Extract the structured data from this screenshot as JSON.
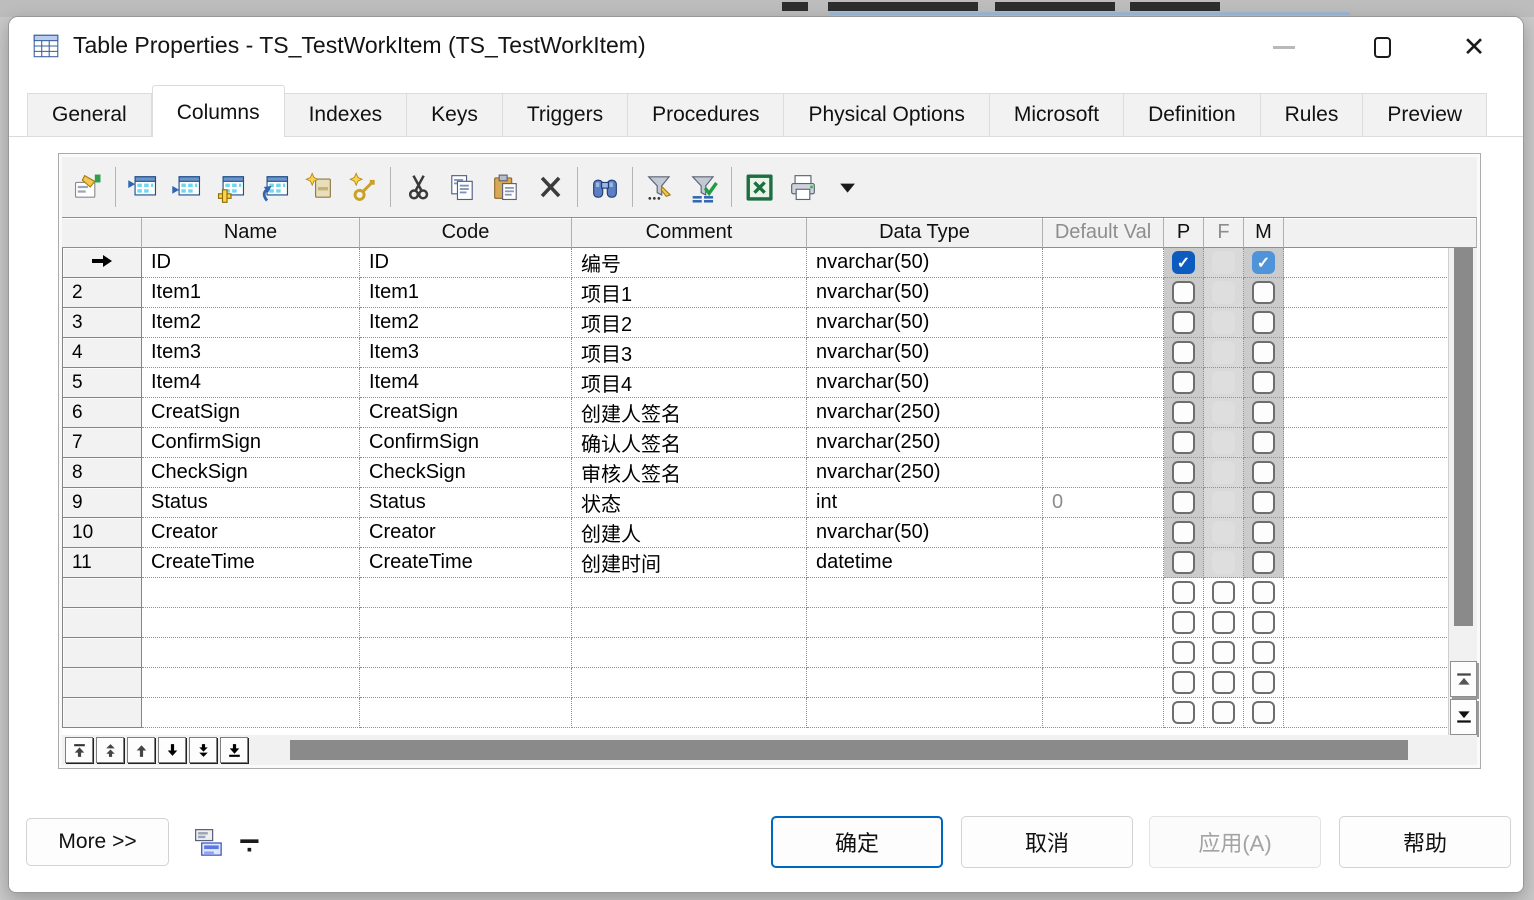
{
  "window": {
    "title": "Table Properties - TS_TestWorkItem (TS_TestWorkItem)"
  },
  "tabs": [
    {
      "label": "General",
      "active": false
    },
    {
      "label": "Columns",
      "active": true
    },
    {
      "label": "Indexes",
      "active": false
    },
    {
      "label": "Keys",
      "active": false
    },
    {
      "label": "Triggers",
      "active": false
    },
    {
      "label": "Procedures",
      "active": false
    },
    {
      "label": "Physical Options",
      "active": false
    },
    {
      "label": "Microsoft",
      "active": false
    },
    {
      "label": "Definition",
      "active": false
    },
    {
      "label": "Rules",
      "active": false
    },
    {
      "label": "Preview",
      "active": false
    }
  ],
  "toolbar": {
    "groups": [
      [
        "properties"
      ],
      [
        "insert-row-top",
        "insert-row",
        "add-row",
        "reorder-rows",
        "remove-summary",
        "generate-key"
      ],
      [
        "cut",
        "copy",
        "paste",
        "delete"
      ],
      [
        "find"
      ],
      [
        "filter-define",
        "filter-toggle"
      ],
      [
        "export-excel",
        "print",
        "print-dropdown"
      ]
    ]
  },
  "grid": {
    "headers": {
      "rowhdr": "",
      "name": "Name",
      "code": "Code",
      "comment": "Comment",
      "data_type": "Data Type",
      "default_value": "Default Val",
      "p": "P",
      "f": "F",
      "m": "M"
    },
    "rows": [
      {
        "num": "",
        "current": true,
        "name": "ID",
        "code": "ID",
        "comment": "编号",
        "data_type": "nvarchar(50)",
        "default_value": "",
        "p": "checked",
        "f": "disabled",
        "m": "checked"
      },
      {
        "num": "2",
        "current": false,
        "name": "Item1",
        "code": "Item1",
        "comment": "项目1",
        "data_type": "nvarchar(50)",
        "default_value": "",
        "p": "unchecked",
        "f": "disabled",
        "m": "unchecked"
      },
      {
        "num": "3",
        "current": false,
        "name": "Item2",
        "code": "Item2",
        "comment": "项目2",
        "data_type": "nvarchar(50)",
        "default_value": "",
        "p": "unchecked",
        "f": "disabled",
        "m": "unchecked"
      },
      {
        "num": "4",
        "current": false,
        "name": "Item3",
        "code": "Item3",
        "comment": "项目3",
        "data_type": "nvarchar(50)",
        "default_value": "",
        "p": "unchecked",
        "f": "disabled",
        "m": "unchecked"
      },
      {
        "num": "5",
        "current": false,
        "name": "Item4",
        "code": "Item4",
        "comment": "项目4",
        "data_type": "nvarchar(50)",
        "default_value": "",
        "p": "unchecked",
        "f": "disabled",
        "m": "unchecked"
      },
      {
        "num": "6",
        "current": false,
        "name": "CreatSign",
        "code": "CreatSign",
        "comment": "创建人签名",
        "data_type": "nvarchar(250)",
        "default_value": "",
        "p": "unchecked",
        "f": "disabled",
        "m": "unchecked"
      },
      {
        "num": "7",
        "current": false,
        "name": "ConfirmSign",
        "code": "ConfirmSign",
        "comment": "确认人签名",
        "data_type": "nvarchar(250)",
        "default_value": "",
        "p": "unchecked",
        "f": "disabled",
        "m": "unchecked"
      },
      {
        "num": "8",
        "current": false,
        "name": "CheckSign",
        "code": "CheckSign",
        "comment": "审核人签名",
        "data_type": "nvarchar(250)",
        "default_value": "",
        "p": "unchecked",
        "f": "disabled",
        "m": "unchecked"
      },
      {
        "num": "9",
        "current": false,
        "name": "Status",
        "code": "Status",
        "comment": "状态",
        "data_type": "int",
        "default_value": "0",
        "p": "unchecked",
        "f": "disabled",
        "m": "unchecked"
      },
      {
        "num": "10",
        "current": false,
        "name": "Creator",
        "code": "Creator",
        "comment": "创建人",
        "data_type": "nvarchar(50)",
        "default_value": "",
        "p": "unchecked",
        "f": "disabled",
        "m": "unchecked"
      },
      {
        "num": "11",
        "current": false,
        "name": "CreateTime",
        "code": "CreateTime",
        "comment": "创建时间",
        "data_type": "datetime",
        "default_value": "",
        "p": "unchecked",
        "f": "disabled",
        "m": "unchecked"
      }
    ],
    "empty_row_count": 5,
    "move_buttons": [
      "move-top",
      "move-up-multi",
      "move-up",
      "move-down",
      "move-down-multi",
      "move-bottom"
    ]
  },
  "footer": {
    "more": "More >>",
    "ok": "确定",
    "cancel": "取消",
    "apply": "应用(A)",
    "help": "帮助"
  },
  "colors": {
    "p_checked": "#0e5bc0",
    "m_checked": "#4f93d8",
    "default_button_border": "#0067c0",
    "scroll_thumb": "#8a8a8a",
    "checkbox_column_bg": "#cbcbcb"
  }
}
